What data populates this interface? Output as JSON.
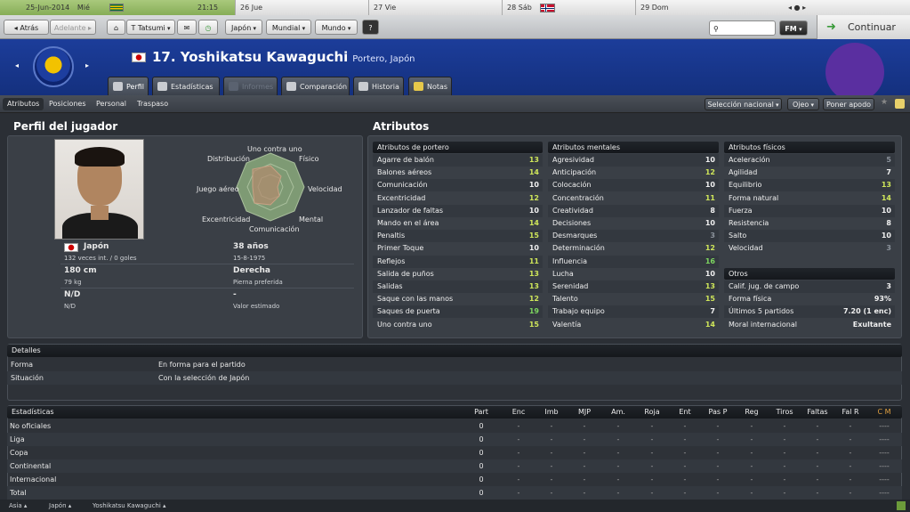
{
  "calendar": {
    "date_today": "25-Jun-2014",
    "weekday_today": "Mié",
    "time": "21:15",
    "days": [
      {
        "label": "26",
        "day": "Jue"
      },
      {
        "label": "27",
        "day": "Vie"
      },
      {
        "label": "28",
        "day": "Sáb"
      },
      {
        "label": "29",
        "day": "Dom"
      }
    ]
  },
  "nav": {
    "back": "Atrás",
    "forward": "Adelante",
    "manager": "T Tatsumi",
    "team": "Japón",
    "competition": "Mundial",
    "region": "Mundo",
    "help": "?",
    "fm": "FM",
    "continue": "Continuar"
  },
  "player": {
    "number_name": "17. Yoshikatsu Kawaguchi",
    "position": "Portero, Japón"
  },
  "tabs": [
    "Perfil",
    "Estadísticas",
    "Informes",
    "Comparación",
    "Historia",
    "Notas"
  ],
  "subtabs": [
    "Atributos",
    "Posiciones",
    "Personal",
    "Traspaso"
  ],
  "actions": {
    "selection": "Selección nacional",
    "scout": "Ojeo",
    "loan": "Poner apodo"
  },
  "profile": {
    "heading": "Perfil del jugador",
    "nationality": "Japón",
    "caps": "132 veces int. / 0 goles",
    "age": "38 años",
    "dob": "15-8-1975",
    "height": "180 cm",
    "weight": "79 kg",
    "foot": "Derecha",
    "foot_label": "Pierna preferida",
    "value_a": "N/D",
    "value_a_sub": "N/D",
    "value_b": "-",
    "value_b_label": "Valor estimado",
    "radar": {
      "top": "Uno contra uno",
      "tl": "Distribución",
      "tr": "Físico",
      "l": "Juego aéreo",
      "r": "Velocidad",
      "bl": "Excentricidad",
      "br": "Mental",
      "bottom": "Comunicación"
    }
  },
  "attributes": {
    "heading": "Atributos",
    "goalkeeping": {
      "title": "Atributos de portero",
      "rows": [
        {
          "name": "Agarre de balón",
          "value": "13",
          "tone": "g"
        },
        {
          "name": "Balones aéreos",
          "value": "14",
          "tone": "g"
        },
        {
          "name": "Comunicación",
          "value": "10",
          "tone": "w"
        },
        {
          "name": "Excentricidad",
          "value": "12",
          "tone": "g"
        },
        {
          "name": "Lanzador de faltas",
          "value": "10",
          "tone": "w"
        },
        {
          "name": "Mando en el área",
          "value": "14",
          "tone": "g"
        },
        {
          "name": "Penaltis",
          "value": "15",
          "tone": "g"
        },
        {
          "name": "Primer Toque",
          "value": "10",
          "tone": "w"
        },
        {
          "name": "Reflejos",
          "value": "11",
          "tone": "g"
        },
        {
          "name": "Salida de puños",
          "value": "13",
          "tone": "g"
        },
        {
          "name": "Salidas",
          "value": "13",
          "tone": "g"
        },
        {
          "name": "Saque con las manos",
          "value": "12",
          "tone": "g"
        },
        {
          "name": "Saques de puerta",
          "value": "19",
          "tone": "gr"
        },
        {
          "name": "Uno contra uno",
          "value": "15",
          "tone": "g"
        }
      ]
    },
    "mental": {
      "title": "Atributos mentales",
      "rows": [
        {
          "name": "Agresividad",
          "value": "10",
          "tone": "w"
        },
        {
          "name": "Anticipación",
          "value": "12",
          "tone": "g"
        },
        {
          "name": "Colocación",
          "value": "10",
          "tone": "w"
        },
        {
          "name": "Concentración",
          "value": "11",
          "tone": "g"
        },
        {
          "name": "Creatividad",
          "value": "8",
          "tone": "w"
        },
        {
          "name": "Decisiones",
          "value": "10",
          "tone": "w"
        },
        {
          "name": "Desmarques",
          "value": "3",
          "tone": "d"
        },
        {
          "name": "Determinación",
          "value": "12",
          "tone": "g"
        },
        {
          "name": "Influencia",
          "value": "16",
          "tone": "gr"
        },
        {
          "name": "Lucha",
          "value": "10",
          "tone": "w"
        },
        {
          "name": "Serenidad",
          "value": "13",
          "tone": "g"
        },
        {
          "name": "Talento",
          "value": "15",
          "tone": "g"
        },
        {
          "name": "Trabajo equipo",
          "value": "7",
          "tone": "w"
        },
        {
          "name": "Valentía",
          "value": "14",
          "tone": "g"
        }
      ]
    },
    "physical": {
      "title": "Atributos físicos",
      "rows": [
        {
          "name": "Aceleración",
          "value": "5",
          "tone": "d"
        },
        {
          "name": "Agilidad",
          "value": "7",
          "tone": "w"
        },
        {
          "name": "Equilibrio",
          "value": "13",
          "tone": "g"
        },
        {
          "name": "Forma natural",
          "value": "14",
          "tone": "g"
        },
        {
          "name": "Fuerza",
          "value": "10",
          "tone": "w"
        },
        {
          "name": "Resistencia",
          "value": "8",
          "tone": "w"
        },
        {
          "name": "Salto",
          "value": "10",
          "tone": "w"
        },
        {
          "name": "Velocidad",
          "value": "3",
          "tone": "d"
        }
      ]
    },
    "other": {
      "title": "Otros",
      "rows": [
        {
          "name": "Calif. jug. de campo",
          "value": "3",
          "tone": "w"
        },
        {
          "name": "Forma física",
          "value": "93%",
          "tone": "w"
        },
        {
          "name": "Últimos 5 partidos",
          "value": "7.20 (1 enc)",
          "tone": "w"
        },
        {
          "name": "Moral internacional",
          "value": "Exultante",
          "tone": "w"
        }
      ]
    }
  },
  "details": {
    "heading": "Detalles",
    "rows": [
      {
        "label": "Forma",
        "value": "En forma para el partido"
      },
      {
        "label": "Situación",
        "value": "Con la selección de Japón"
      }
    ]
  },
  "stats": {
    "heading": "Estadísticas",
    "columns": [
      "Part",
      "Enc",
      "Imb",
      "MJP",
      "Am.",
      "Roja",
      "Ent",
      "Pas P",
      "Reg",
      "Tiros",
      "Faltas",
      "Fal R",
      "C M"
    ],
    "rows": [
      {
        "label": "No oficiales",
        "part": "0",
        "dash": "-",
        "cm": "----"
      },
      {
        "label": "Liga",
        "part": "0",
        "dash": "-",
        "cm": "----"
      },
      {
        "label": "Copa",
        "part": "0",
        "dash": "-",
        "cm": "----"
      },
      {
        "label": "Continental",
        "part": "0",
        "dash": "-",
        "cm": "----"
      },
      {
        "label": "Internacional",
        "part": "0",
        "dash": "-",
        "cm": "----"
      },
      {
        "label": "Total",
        "part": "0",
        "dash": "-",
        "cm": "----"
      }
    ]
  },
  "breadcrumb": [
    "Asia",
    "Japón",
    "Yoshikatsu Kawaguchi"
  ],
  "colors": {
    "accent_green": "#cfe65a",
    "bright_green": "#7dd660",
    "header_blue": "#1c3d9a"
  }
}
